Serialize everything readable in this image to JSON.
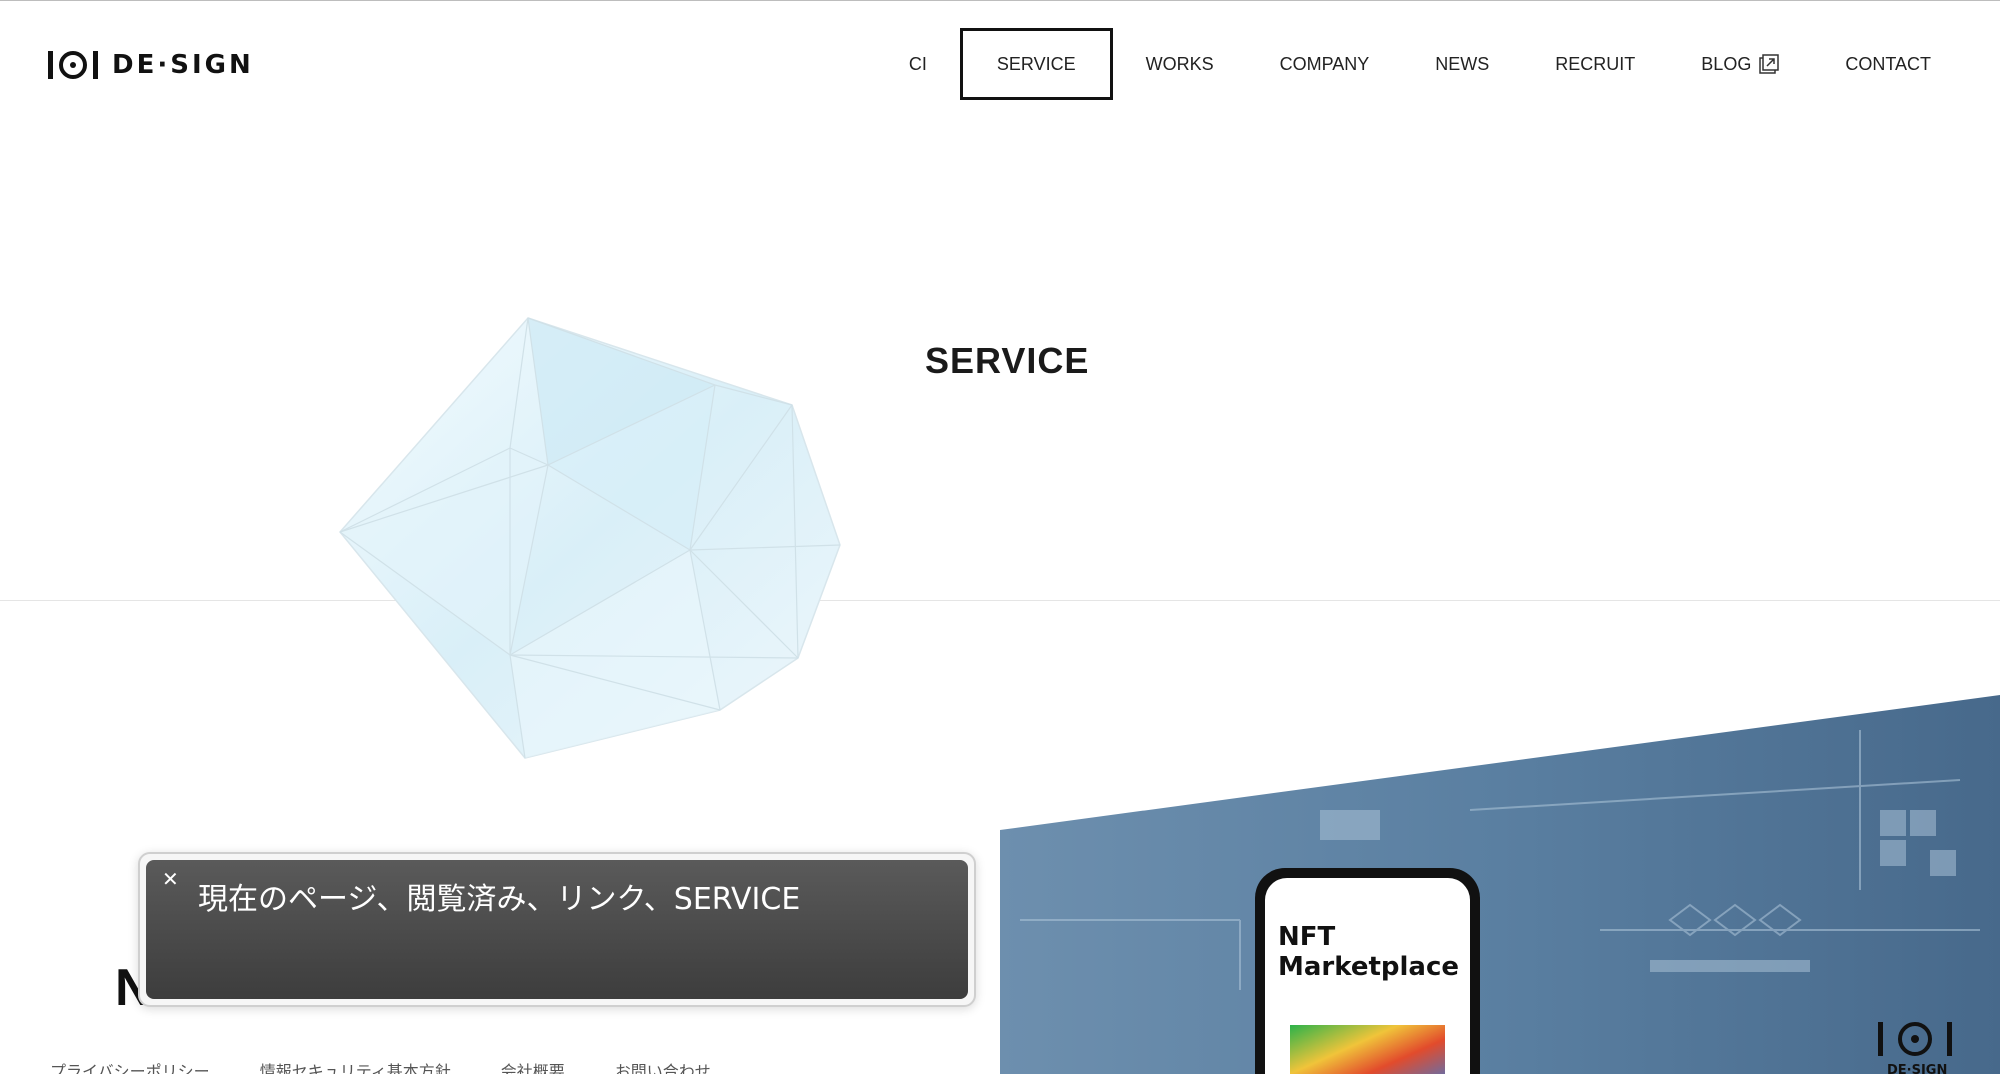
{
  "brand": {
    "logo_text": "DE·SIGN"
  },
  "nav": {
    "items": [
      {
        "label": "CI"
      },
      {
        "label": "SERVICE",
        "active": true
      },
      {
        "label": "WORKS"
      },
      {
        "label": "COMPANY"
      },
      {
        "label": "NEWS"
      },
      {
        "label": "RECRUIT"
      },
      {
        "label": "BLOG",
        "external": true
      },
      {
        "label": "CONTACT"
      }
    ]
  },
  "hero": {
    "title": "SERVICE"
  },
  "section": {
    "partial_heading": "N"
  },
  "photo": {
    "phone_title_line1": "NFT",
    "phone_title_line2": "Marketplace",
    "corner_logo_text": "DE·SIGN"
  },
  "footer": {
    "links": [
      "プライバシーポリシー",
      "情報セキュリティ基本方針",
      "会社概要",
      "お問い合わせ"
    ]
  },
  "voiceover": {
    "text": "現在のページ、閲覧済み、リンク、SERVICE",
    "close_icon": "close-icon"
  },
  "colors": {
    "accent_dark": "#111111",
    "caption_bg": "#4a4a4a",
    "polyhedron_tint": "#d6eef8",
    "photo_bg": "#4f7598"
  }
}
